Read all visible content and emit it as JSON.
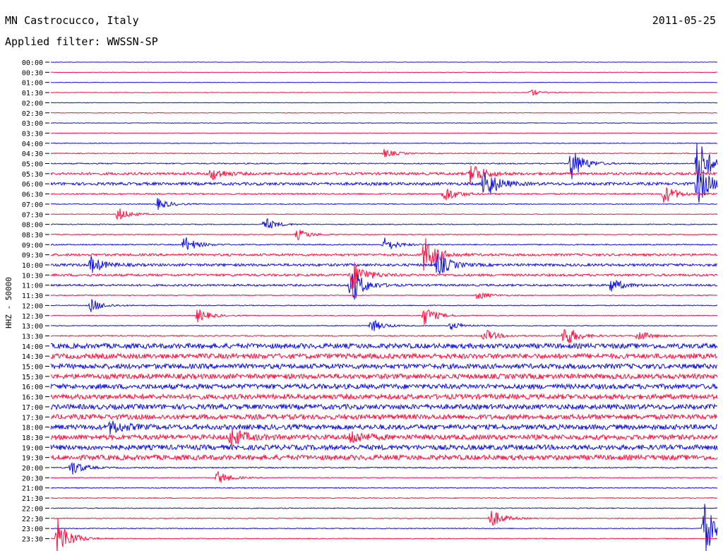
{
  "header": {
    "station": "MN Castrocucco, Italy",
    "date": "2011-05-25",
    "filter": "Applied filter: WWSSN-SP"
  },
  "y_axis_label": "HHZ - 50000",
  "colors": {
    "blue": "#1010e0",
    "red": "#ff1040"
  },
  "chart_data": {
    "type": "line",
    "title": "MN Castrocucco, Italy",
    "subtitle": "Applied filter: WWSSN-SP",
    "ylabel": "HHZ - 50000",
    "tick_labels": [
      "00:00",
      "00:30",
      "01:00",
      "01:30",
      "02:00",
      "02:30",
      "03:00",
      "03:30",
      "04:00",
      "04:30",
      "05:00",
      "05:30",
      "06:00",
      "06:30",
      "07:00",
      "07:30",
      "08:00",
      "08:30",
      "09:00",
      "09:30",
      "10:00",
      "10:30",
      "11:00",
      "11:30",
      "12:00",
      "12:30",
      "13:00",
      "13:30",
      "14:00",
      "14:30",
      "15:00",
      "15:30",
      "16:00",
      "16:30",
      "17:00",
      "17:30",
      "18:00",
      "18:30",
      "19:00",
      "19:30",
      "20:00",
      "20:30",
      "21:00",
      "21:30",
      "22:00",
      "22:30",
      "23:00",
      "23:30"
    ],
    "series_colors_alternating": [
      "blue",
      "red"
    ],
    "trace_noise_level": [
      0.3,
      0.3,
      0.3,
      0.4,
      0.4,
      0.4,
      0.4,
      0.4,
      0.5,
      0.6,
      0.8,
      1.8,
      2.0,
      1.0,
      0.6,
      0.5,
      0.6,
      0.6,
      0.8,
      1.6,
      1.8,
      1.6,
      1.4,
      0.6,
      0.6,
      0.6,
      0.6,
      0.8,
      3.5,
      3.5,
      3.5,
      3.5,
      3.5,
      3.5,
      3.5,
      3.5,
      3.5,
      3.5,
      3.5,
      3.5,
      0.8,
      0.6,
      0.6,
      0.6,
      0.6,
      0.6,
      0.6,
      0.6
    ],
    "events": [
      {
        "trace": 3,
        "x": 0.72,
        "amp": 4
      },
      {
        "trace": 9,
        "x": 0.5,
        "amp": 6
      },
      {
        "trace": 10,
        "x": 0.78,
        "amp": 25
      },
      {
        "trace": 10,
        "x": 0.97,
        "amp": 40
      },
      {
        "trace": 11,
        "x": 0.24,
        "amp": 10
      },
      {
        "trace": 11,
        "x": 0.63,
        "amp": 18
      },
      {
        "trace": 12,
        "x": 0.65,
        "amp": 25
      },
      {
        "trace": 12,
        "x": 0.97,
        "amp": 30
      },
      {
        "trace": 13,
        "x": 0.59,
        "amp": 12
      },
      {
        "trace": 13,
        "x": 0.92,
        "amp": 14
      },
      {
        "trace": 14,
        "x": 0.16,
        "amp": 8
      },
      {
        "trace": 15,
        "x": 0.1,
        "amp": 10
      },
      {
        "trace": 16,
        "x": 0.32,
        "amp": 10
      },
      {
        "trace": 17,
        "x": 0.37,
        "amp": 8
      },
      {
        "trace": 18,
        "x": 0.2,
        "amp": 12
      },
      {
        "trace": 18,
        "x": 0.5,
        "amp": 10
      },
      {
        "trace": 19,
        "x": 0.56,
        "amp": 28
      },
      {
        "trace": 20,
        "x": 0.06,
        "amp": 12
      },
      {
        "trace": 20,
        "x": 0.58,
        "amp": 18
      },
      {
        "trace": 21,
        "x": 0.45,
        "amp": 25
      },
      {
        "trace": 22,
        "x": 0.45,
        "amp": 28
      },
      {
        "trace": 22,
        "x": 0.84,
        "amp": 10
      },
      {
        "trace": 23,
        "x": 0.64,
        "amp": 6
      },
      {
        "trace": 24,
        "x": 0.06,
        "amp": 10
      },
      {
        "trace": 25,
        "x": 0.22,
        "amp": 10
      },
      {
        "trace": 25,
        "x": 0.56,
        "amp": 14
      },
      {
        "trace": 26,
        "x": 0.48,
        "amp": 10
      },
      {
        "trace": 26,
        "x": 0.6,
        "amp": 6
      },
      {
        "trace": 27,
        "x": 0.65,
        "amp": 10
      },
      {
        "trace": 27,
        "x": 0.77,
        "amp": 18
      },
      {
        "trace": 27,
        "x": 0.88,
        "amp": 8
      },
      {
        "trace": 36,
        "x": 0.09,
        "amp": 10
      },
      {
        "trace": 37,
        "x": 0.27,
        "amp": 14
      },
      {
        "trace": 37,
        "x": 0.45,
        "amp": 10
      },
      {
        "trace": 40,
        "x": 0.03,
        "amp": 12
      },
      {
        "trace": 41,
        "x": 0.25,
        "amp": 10
      },
      {
        "trace": 45,
        "x": 0.66,
        "amp": 14
      },
      {
        "trace": 46,
        "x": 0.98,
        "amp": 40
      },
      {
        "trace": 47,
        "x": 0.01,
        "amp": 30
      }
    ]
  }
}
